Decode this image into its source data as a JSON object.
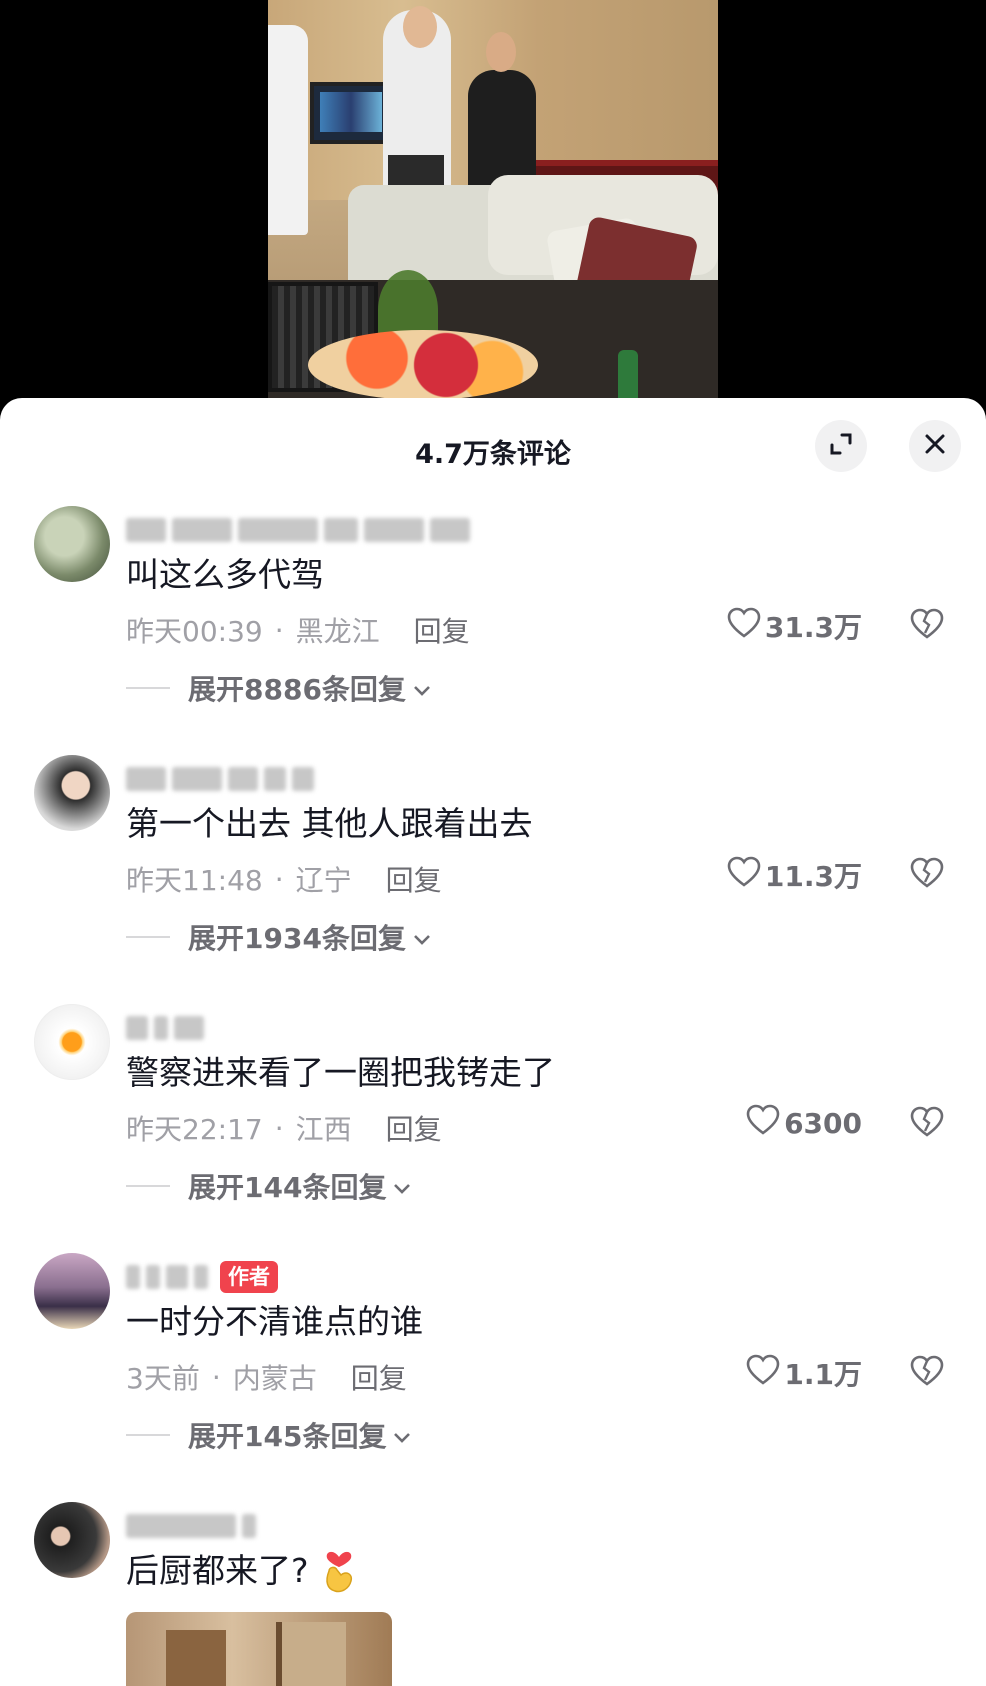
{
  "panel": {
    "title": "4.7万条评论"
  },
  "comments": [
    {
      "text": "叫这么多代驾",
      "time": "昨天00:39",
      "location": "黑龙江",
      "reply_label": "回复",
      "likes": "31.3万",
      "expand_label": "展开8886条回复",
      "avatar_color": "#7b8a6a"
    },
    {
      "text": "第一个出去 其他人跟着出去",
      "time": "昨天11:48",
      "location": "辽宁",
      "reply_label": "回复",
      "likes": "11.3万",
      "expand_label": "展开1934条回复",
      "avatar_color": "#3a3a3a"
    },
    {
      "text": "警察进来看了一圈把我铐走了",
      "time": "昨天22:17",
      "location": "江西",
      "reply_label": "回复",
      "likes": "6300",
      "expand_label": "展开144条回复",
      "avatar_color": "#f4f4f4"
    },
    {
      "text": "一时分不清谁点的谁",
      "author_badge": "作者",
      "time": "3天前",
      "location": "内蒙古",
      "reply_label": "回复",
      "likes": "1.1万",
      "expand_label": "展开145条回复",
      "avatar_color": "#8a6f8f"
    },
    {
      "text": "后厨都来了?",
      "avatar_color": "#2b2b2b"
    }
  ],
  "icons": {
    "expand": "expand-icon",
    "close": "close-icon",
    "like": "heart-outline-icon",
    "dislike": "broken-heart-icon",
    "chevron": "chevron-down-icon",
    "emoji": "finger-heart-emoji"
  },
  "colors": {
    "author_badge": "#f0434d",
    "text_primary": "#161823",
    "text_secondary": "#a0a0a6"
  }
}
